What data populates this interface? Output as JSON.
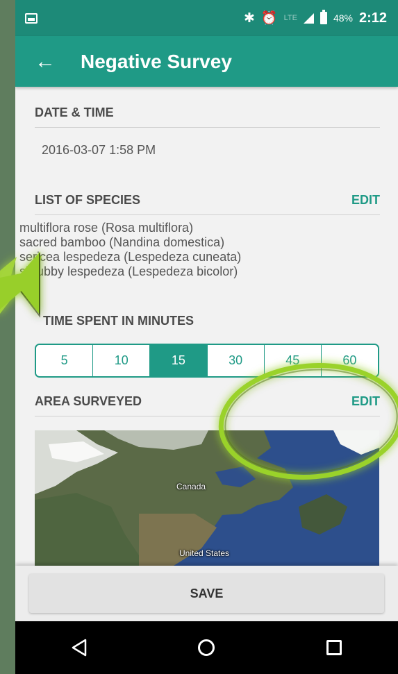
{
  "status_bar": {
    "lte": "LTE",
    "battery_percent": "48%",
    "time": "2:12"
  },
  "app_bar": {
    "title": "Negative Survey"
  },
  "date_section": {
    "header": "DATE & TIME",
    "value": "2016-03-07 1:58 PM"
  },
  "species_section": {
    "header": "LIST OF SPECIES",
    "edit_label": "EDIT",
    "items": [
      "multiflora rose (Rosa multiflora)",
      "sacred bamboo (Nandina domestica)",
      "sericea lespedeza (Lespedeza cuneata)",
      "shrubby lespedeza (Lespedeza bicolor)"
    ]
  },
  "time_section": {
    "header": "TIME SPENT IN MINUTES",
    "options": [
      "5",
      "10",
      "15",
      "30",
      "45",
      "60"
    ],
    "selected": "15"
  },
  "area_section": {
    "header": "AREA SURVEYED",
    "edit_label": "EDIT",
    "map_labels": {
      "canada": "Canada",
      "united_states": "United States"
    }
  },
  "save_label": "SAVE",
  "colors": {
    "primary": "#1f9a86",
    "status_bar": "#1d8a78",
    "annotation": "#9ad22a"
  }
}
